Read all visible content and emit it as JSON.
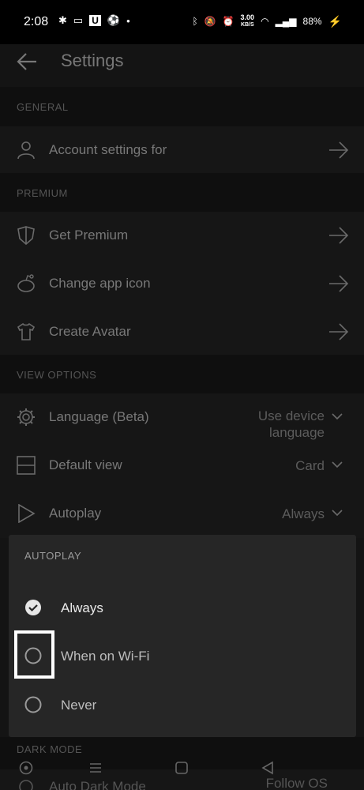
{
  "status_bar": {
    "time": "2:08",
    "network_speed_value": "3.00",
    "network_speed_unit": "KB/S",
    "battery": "88%"
  },
  "header": {
    "title": "Settings"
  },
  "sections": {
    "general": "GENERAL",
    "premium": "PREMIUM",
    "view_options": "VIEW OPTIONS",
    "dark_mode": "DARK MODE"
  },
  "rows": {
    "account": "Account settings for",
    "get_premium": "Get Premium",
    "change_icon": "Change app icon",
    "create_avatar": "Create Avatar",
    "language": "Language (Beta)",
    "language_value_line1": "Use device",
    "language_value_line2": "language",
    "default_view": "Default view",
    "default_view_value": "Card",
    "autoplay": "Autoplay",
    "autoplay_value": "Always",
    "auto_dark_mode": "Auto Dark Mode",
    "auto_dark_mode_value": "Follow OS"
  },
  "dialog": {
    "title": "AUTOPLAY",
    "options": [
      {
        "label": "Always",
        "selected": true
      },
      {
        "label": "When on Wi-Fi",
        "selected": false
      },
      {
        "label": "Never",
        "selected": false
      }
    ]
  }
}
